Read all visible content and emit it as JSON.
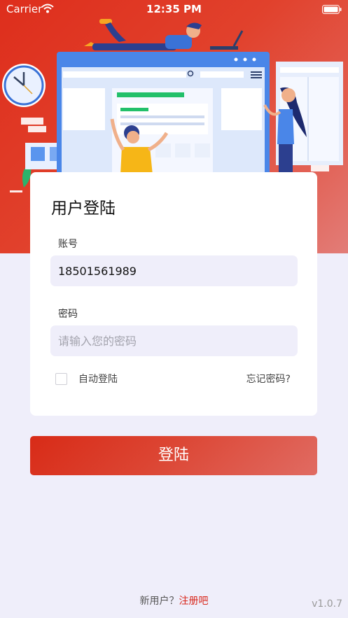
{
  "status_bar": {
    "carrier": "Carrier",
    "time": "12:35 PM",
    "wifi_icon": "wifi-icon",
    "battery_icon": "battery-icon"
  },
  "login_card": {
    "title": "用户登陆",
    "account": {
      "label": "账号",
      "value": "18501561989"
    },
    "password": {
      "label": "密码",
      "placeholder": "请输入您的密码",
      "value": ""
    },
    "auto_login": {
      "label": "自动登陆",
      "checked": false
    },
    "forgot_password": "忘记密码?"
  },
  "login_button": "登陆",
  "footer": {
    "new_user": "新用户？",
    "register": "注册吧",
    "version": "v1.0.7"
  },
  "colors": {
    "brand_red": "#de2e1c",
    "register_link": "#d8261a",
    "page_bg": "#efeefa",
    "illustration_blue": "#4a86e8"
  }
}
